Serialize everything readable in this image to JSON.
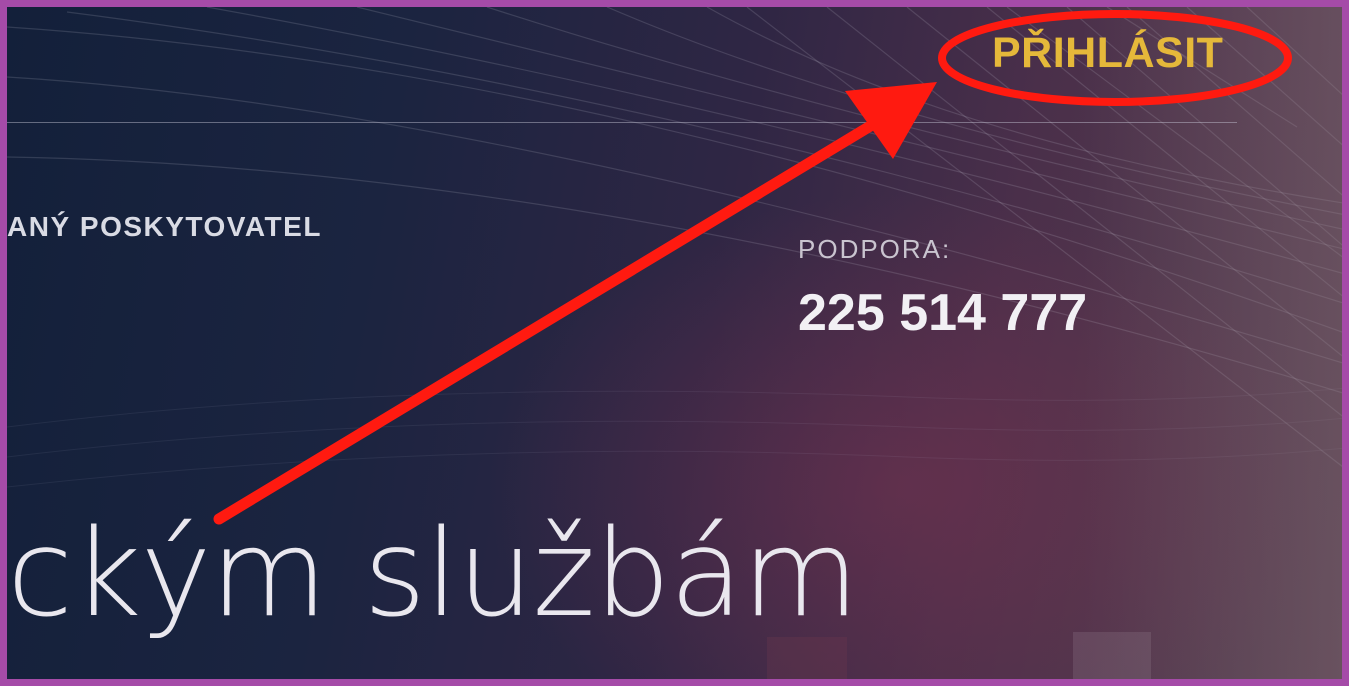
{
  "header": {
    "login_label": "PŘIHLÁSIT"
  },
  "intro": {
    "provider_text": "ANÝ POSKYTOVATEL"
  },
  "support": {
    "label": "PODPORA:",
    "phone": "225 514 777"
  },
  "hero": {
    "text": "ckým službám"
  },
  "annotation": {
    "color": "#ff1a10",
    "shapes": [
      "ellipse-highlight",
      "arrow"
    ]
  },
  "colors": {
    "accent": "#e5b83a",
    "frame": "#a54ba8"
  }
}
